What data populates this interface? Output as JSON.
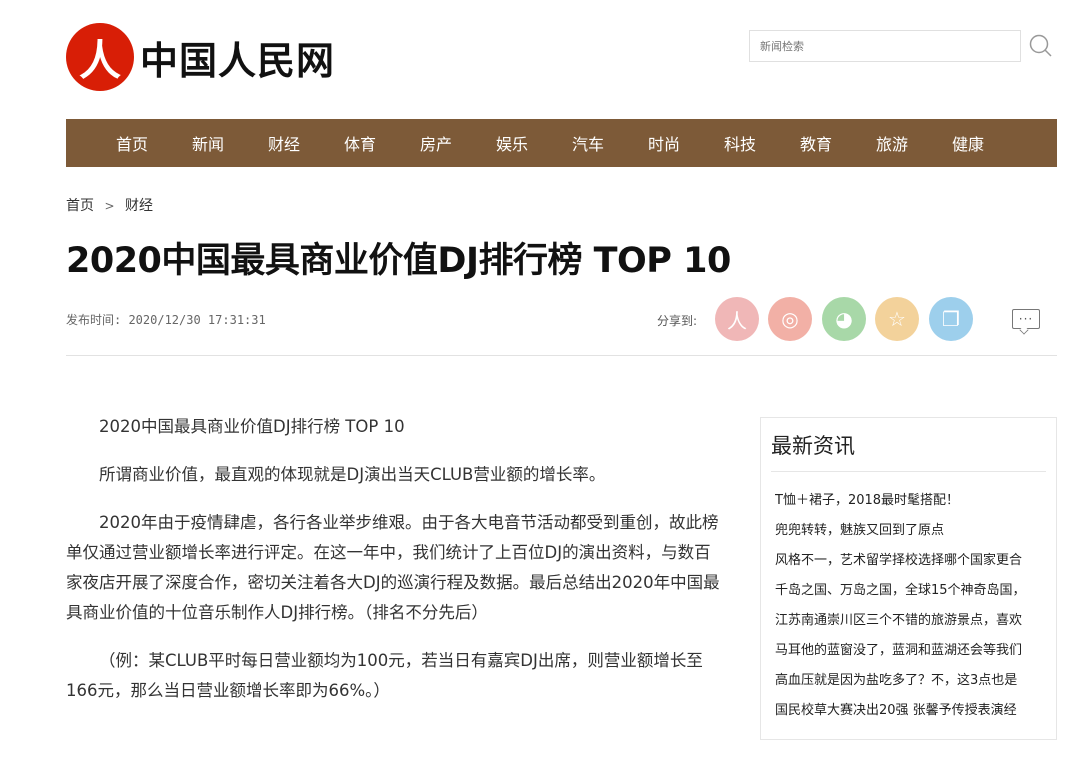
{
  "site": {
    "logo_mark": "人",
    "logo_text": "中国人民网"
  },
  "search": {
    "placeholder": "新闻检索"
  },
  "nav": [
    "首页",
    "新闻",
    "财经",
    "体育",
    "房产",
    "娱乐",
    "汽车",
    "时尚",
    "科技",
    "教育",
    "旅游",
    "健康"
  ],
  "breadcrumb": {
    "home": "首页",
    "separator": ">",
    "current": "财经"
  },
  "article": {
    "title": "2020中国最具商业价值DJ排行榜 TOP 10",
    "publish_time": "发布时间: 2020/12/30 17:31:31",
    "paragraphs": [
      "2020中国最具商业价值DJ排行榜 TOP 10",
      "所谓商业价值，最直观的体现就是DJ演出当天CLUB营业额的增长率。",
      "2020年由于疫情肆虐，各行各业举步维艰。由于各大电音节活动都受到重创，故此榜单仅通过营业额增长率进行评定。在这一年中，我们统计了上百位DJ的演出资料，与数百家夜店开展了深度合作，密切关注着各大DJ的巡演行程及数据。最后总结出2020年中国最具商业价值的十位音乐制作人DJ排行榜。（排名不分先后）",
      "（例：某CLUB平时每日营业额均为100元，若当日有嘉宾DJ出席，则营业额增长至166元，那么当日营业额增长率即为66%。）"
    ]
  },
  "share": {
    "label": "分享到:",
    "icons": [
      {
        "name": "renmin-share-icon",
        "glyph": "人",
        "color": "#f0b7b7"
      },
      {
        "name": "weibo-share-icon",
        "glyph": "◎",
        "color": "#f2b0a6"
      },
      {
        "name": "wechat-share-icon",
        "glyph": "◕",
        "color": "#a8d8a8"
      },
      {
        "name": "favorite-share-icon",
        "glyph": "☆",
        "color": "#f3d29b"
      },
      {
        "name": "copy-share-icon",
        "glyph": "❐",
        "color": "#9dcfec"
      }
    ]
  },
  "comment": {
    "glyph": "···"
  },
  "sidebar": {
    "title": "最新资讯",
    "items": [
      "T恤＋裙子，2018最时髦搭配！",
      "兜兜转转，魅族又回到了原点",
      "风格不一，艺术留学择校选择哪个国家更合",
      "千岛之国、万岛之国，全球15个神奇岛国，",
      "江苏南通崇川区三个不错的旅游景点，喜欢",
      "马耳他的蓝窗没了，蓝洞和蓝湖还会等我们",
      "高血压就是因为盐吃多了？不，这3点也是",
      "国民校草大赛决出20强 张馨予传授表演经"
    ]
  }
}
